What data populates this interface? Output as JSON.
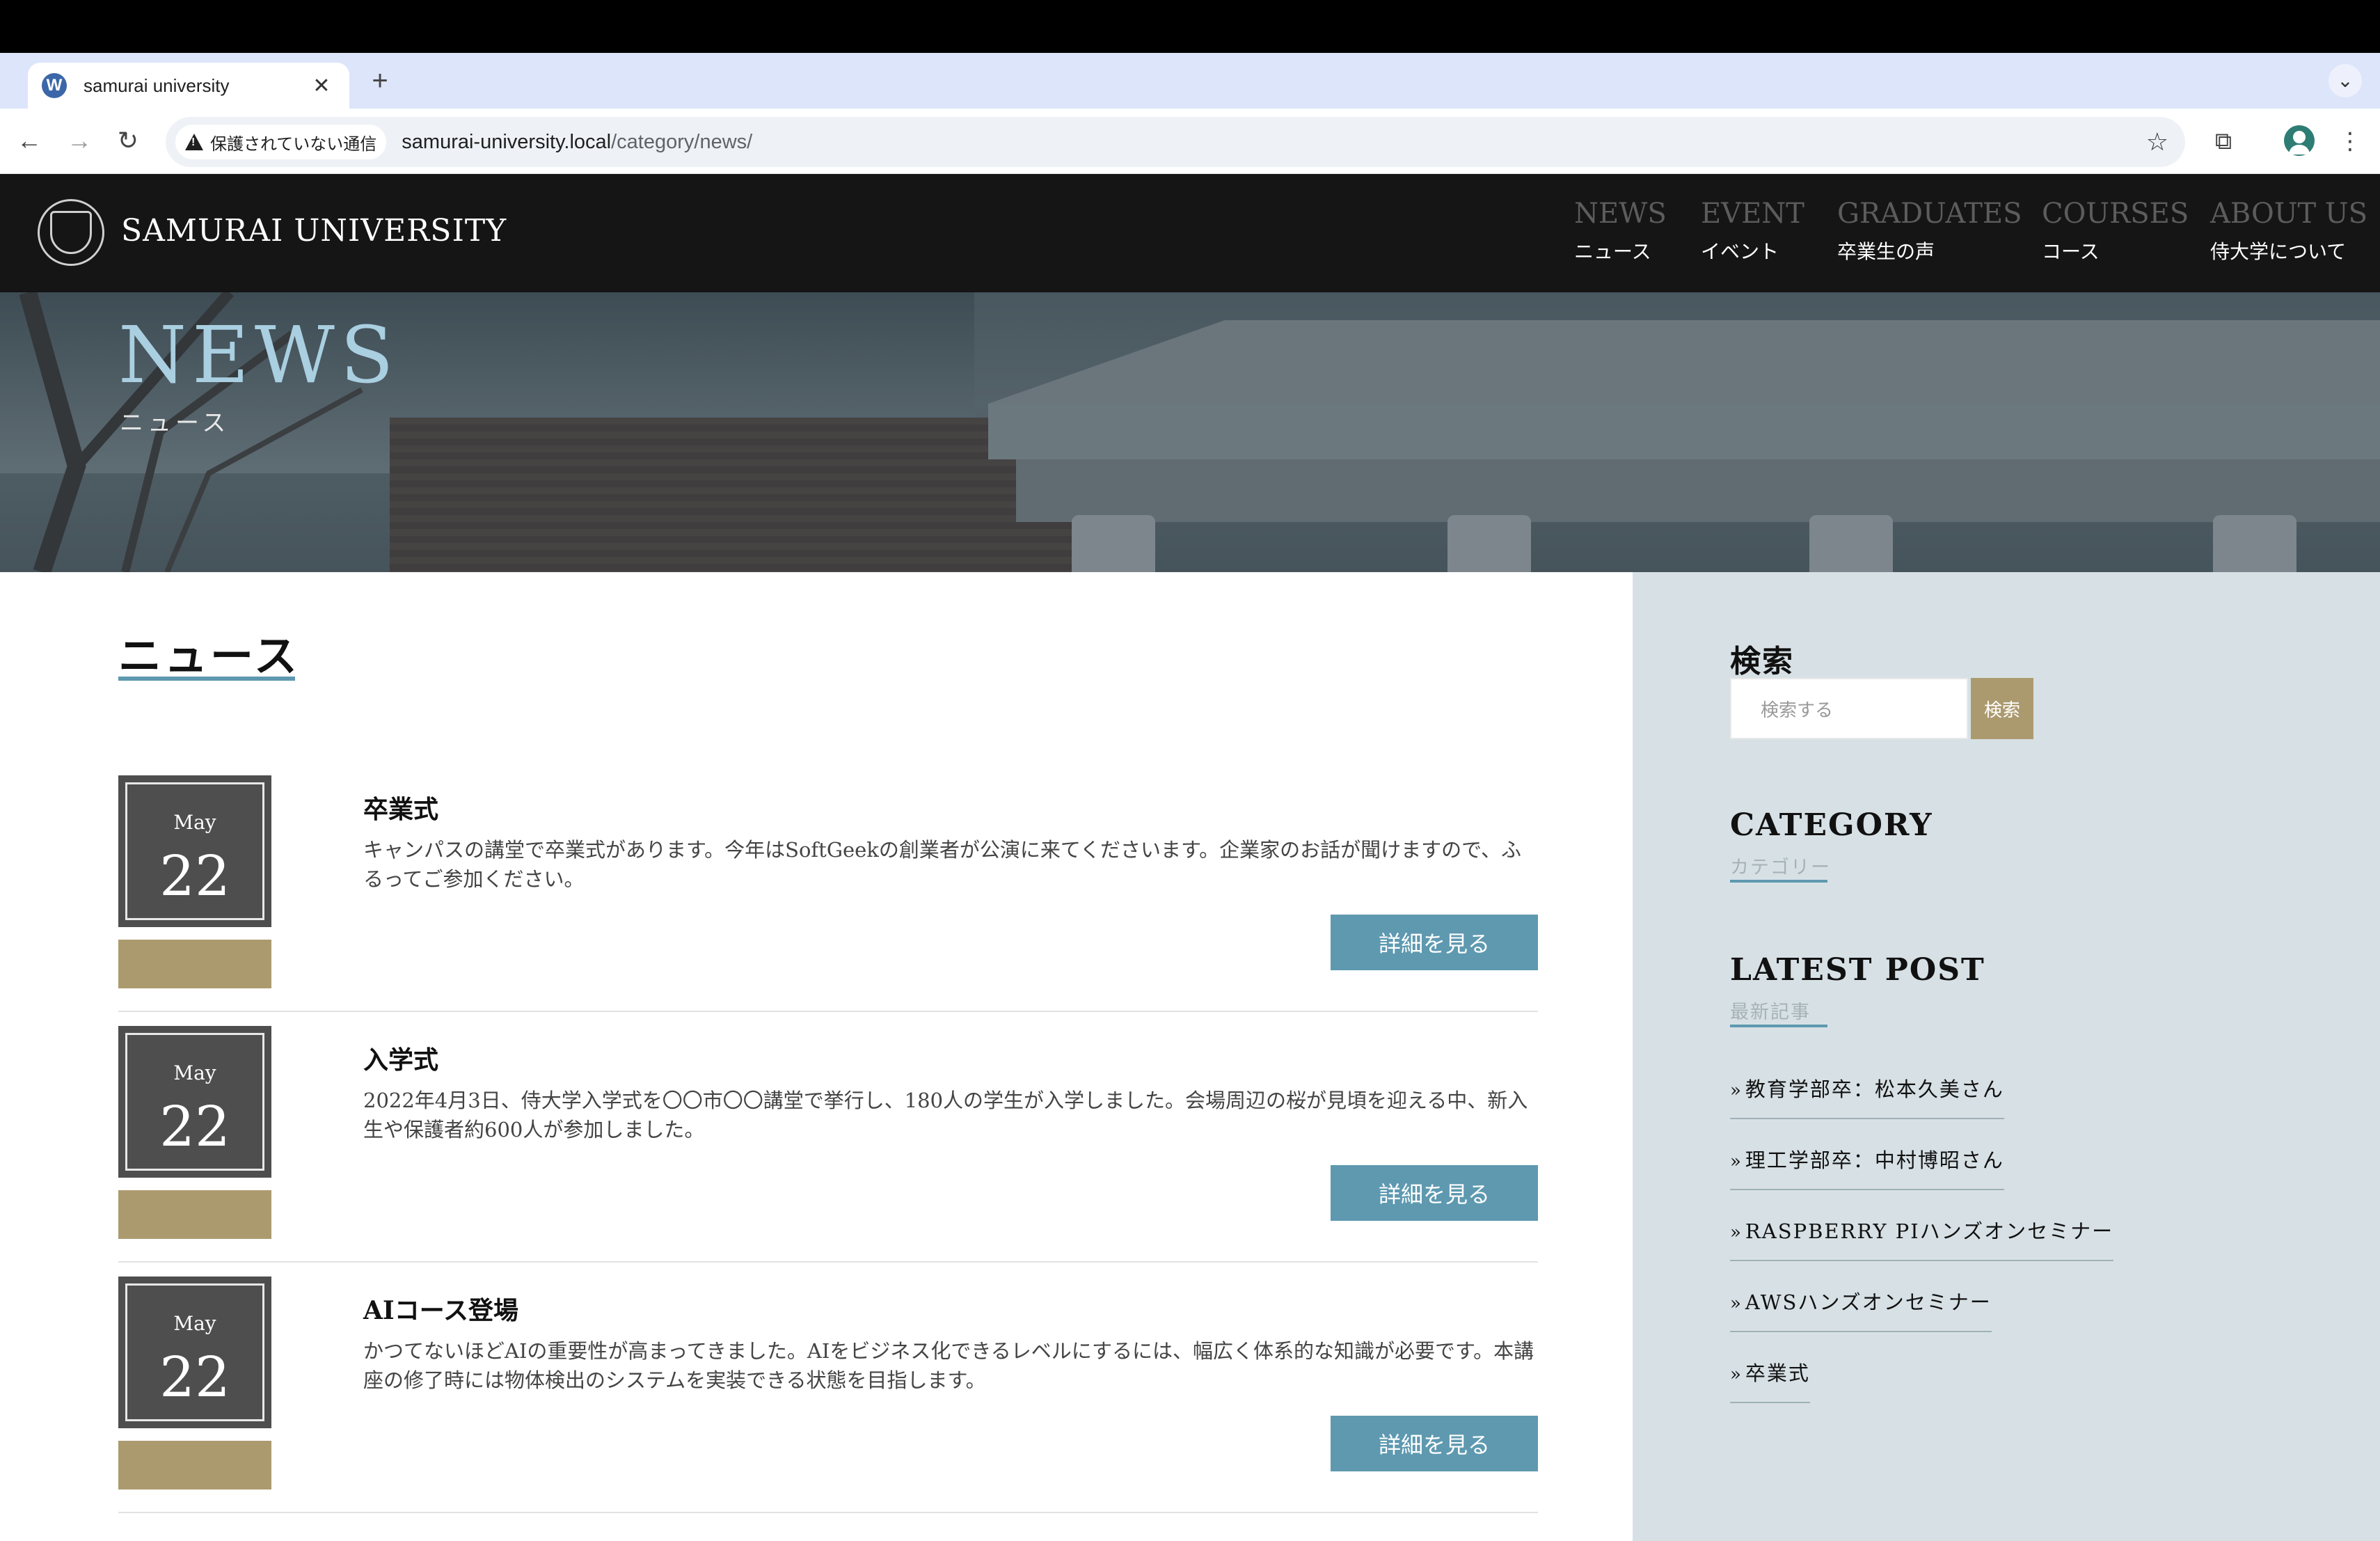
{
  "browser": {
    "tab_title": "samurai university",
    "tab_favicon": "W",
    "tab_close": "✕",
    "new_tab": "+",
    "tab_list": "⌄",
    "security_label": "保護されていない通信",
    "url_host": "samurai-university.local",
    "url_path": "/category/news/",
    "back_icon": "arrow-left-icon",
    "forward_icon": "arrow-right-icon",
    "reload_icon": "reload-icon"
  },
  "site": {
    "name": "SAMURAI UNIVERSITY",
    "nav": [
      {
        "en": "NEWS",
        "ja": "ニュース"
      },
      {
        "en": "EVENT",
        "ja": "イベント"
      },
      {
        "en": "GRADUATES",
        "ja": "卒業生の声"
      },
      {
        "en": "COURSES",
        "ja": "コース"
      },
      {
        "en": "ABOUT US",
        "ja": "侍大学について"
      }
    ]
  },
  "hero": {
    "title": "NEWS",
    "subtitle": "ニュース"
  },
  "main": {
    "heading": "ニュース",
    "posts": [
      {
        "month": "May",
        "day": "22",
        "title": "卒業式",
        "excerpt": "キャンパスの講堂で卒業式があります。今年はSoftGeekの創業者が公演に来てくださいます。企業家のお話が聞けますので、ふるってご参加ください。",
        "button": "詳細を見る"
      },
      {
        "month": "May",
        "day": "22",
        "title": "入学式",
        "excerpt": "2022年4月3日、侍大学入学式を〇〇市〇〇講堂で挙行し、180人の学生が入学しました。会場周辺の桜が見頃を迎える中、新入生や保護者約600人が参加しました。",
        "button": "詳細を見る"
      },
      {
        "month": "May",
        "day": "22",
        "title": "AIコース登場",
        "excerpt": "かつてないほどAIの重要性が高まってきました。AIをビジネス化できるレベルにするには、幅広く体系的な知識が必要です。本講座の修了時には物体検出のシステムを実装できる状態を目指します。",
        "button": "詳細を見る"
      }
    ]
  },
  "sidebar": {
    "search_title": "検索",
    "search_placeholder": "検索する",
    "search_button": "検索",
    "category_title": "CATEGORY",
    "category_sub": "カテゴリー",
    "latest_title": "LATEST POST",
    "latest_sub": "最新記事",
    "latest_posts": [
      "教育学部卒：松本久美さん",
      "理工学部卒：中村博昭さん",
      "RASPBERRY PIハンズオンセミナー",
      "AWSハンズオンセミナー",
      "卒業式"
    ],
    "chevron": "»"
  }
}
